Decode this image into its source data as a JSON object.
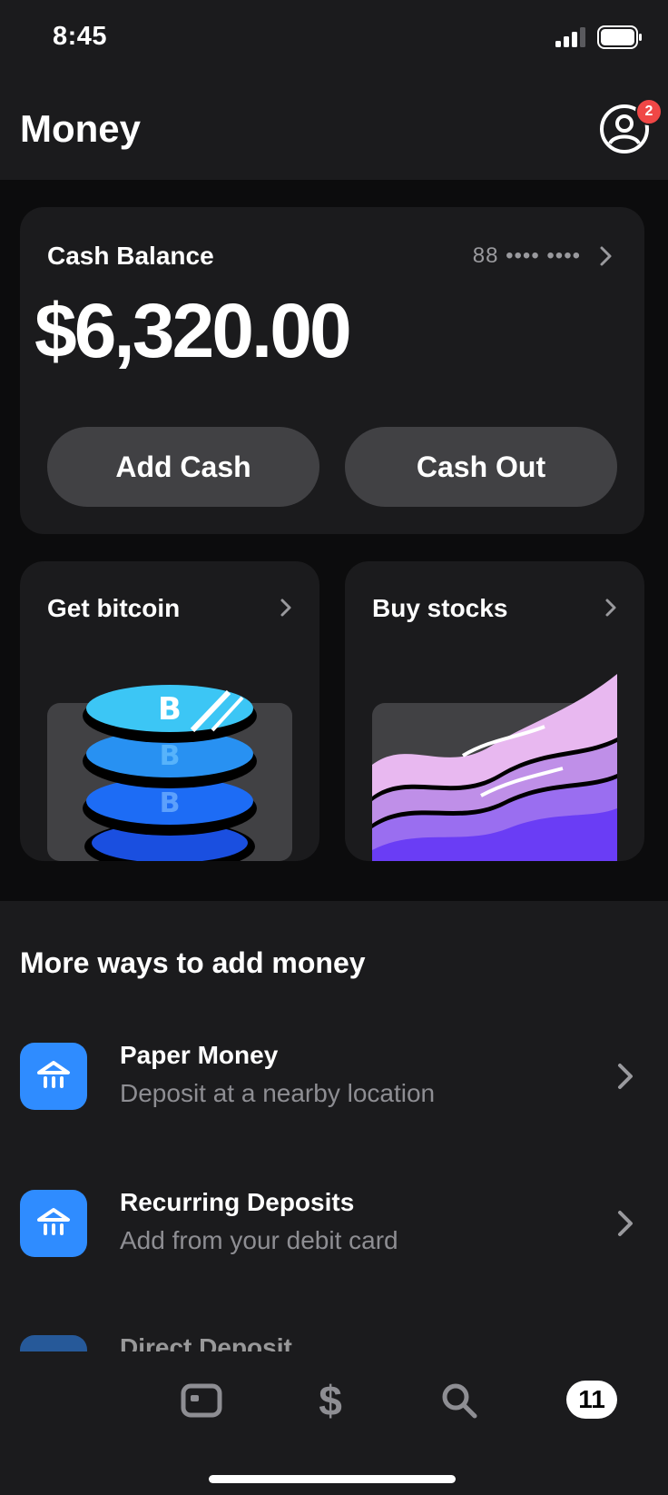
{
  "status_bar": {
    "time": "8:45"
  },
  "header": {
    "title": "Money",
    "notification_count": "2"
  },
  "balance_card": {
    "label": "Cash Balance",
    "account_mask": "88 •••• ••••",
    "amount": "$6,320.00",
    "add_cash_label": "Add Cash",
    "cash_out_label": "Cash Out"
  },
  "tiles": {
    "bitcoin_title": "Get bitcoin",
    "stocks_title": "Buy stocks"
  },
  "more_ways": {
    "title": "More ways to add money",
    "items": [
      {
        "title": "Paper Money",
        "subtitle": "Deposit at a nearby location",
        "icon": "bank-icon"
      },
      {
        "title": "Recurring Deposits",
        "subtitle": "Add from your debit card",
        "icon": "bank-icon"
      },
      {
        "title": "Direct Deposit",
        "subtitle": "",
        "icon": "bank-icon"
      }
    ]
  },
  "tab_bar": {
    "home_icon": "home-icon",
    "money_icon": "$",
    "search_icon": "search-icon",
    "activity_count": "11"
  },
  "colors": {
    "background": "#0c0c0d",
    "card": "#1b1b1d",
    "button": "#414144",
    "accent_blue": "#2f8cff",
    "badge_red": "#f04746"
  }
}
